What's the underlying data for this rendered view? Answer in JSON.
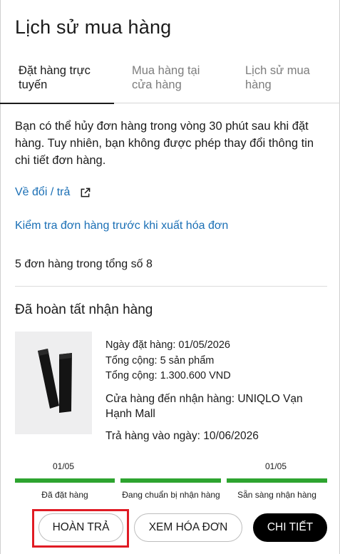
{
  "page": {
    "title": "Lịch sử mua hàng"
  },
  "tabs": [
    {
      "label_line1": "Đặt hàng trực",
      "label_line2": "tuyến",
      "active": true
    },
    {
      "label_line1": "Mua hàng tại",
      "label_line2": "cửa hàng",
      "active": false
    },
    {
      "label_line1": "Lịch sử mua",
      "label_line2": "hàng",
      "active": false
    }
  ],
  "notice": "Bạn có thể hủy đơn hàng trong vòng 30 phút sau khi đặt hàng. Tuy nhiên, bạn không được phép thay đổi thông tin chi tiết đơn hàng.",
  "links": {
    "return_exchange": "Về đổi / trả",
    "check_order": "Kiểm tra đơn hàng trước khi xuất hóa đơn"
  },
  "order_count": "5 đơn hàng trong tổng số 8",
  "order": {
    "status": "Đã hoàn tất nhận hàng",
    "order_date": "Ngày đặt hàng: 01/05/2026",
    "total_items": "Tổng cộng: 5 sản phẩm",
    "total_amount": "Tổng cộng: 1.300.600 VND",
    "pickup_store": "Cửa hàng đến nhận hàng: UNIQLO Vạn Hạnh Mall",
    "return_date": "Trả hàng vào ngày: 10/06/2026"
  },
  "progress": {
    "color": "#2da42f",
    "steps": [
      {
        "date": "01/05",
        "label": "Đã đặt hàng",
        "complete": true
      },
      {
        "date": "",
        "label": "Đang chuẩn bị nhận hàng",
        "complete": true
      },
      {
        "date": "01/05",
        "label": "Sẵn sàng nhận hàng",
        "complete": true
      }
    ]
  },
  "buttons": {
    "return": "HOÀN TRẢ",
    "invoice": "XEM HÓA ĐƠN",
    "details": "CHI TIẾT"
  },
  "icons": {
    "external_link": "external-link-icon"
  },
  "colors": {
    "link": "#1a6fb5",
    "highlight": "#e01b24"
  }
}
